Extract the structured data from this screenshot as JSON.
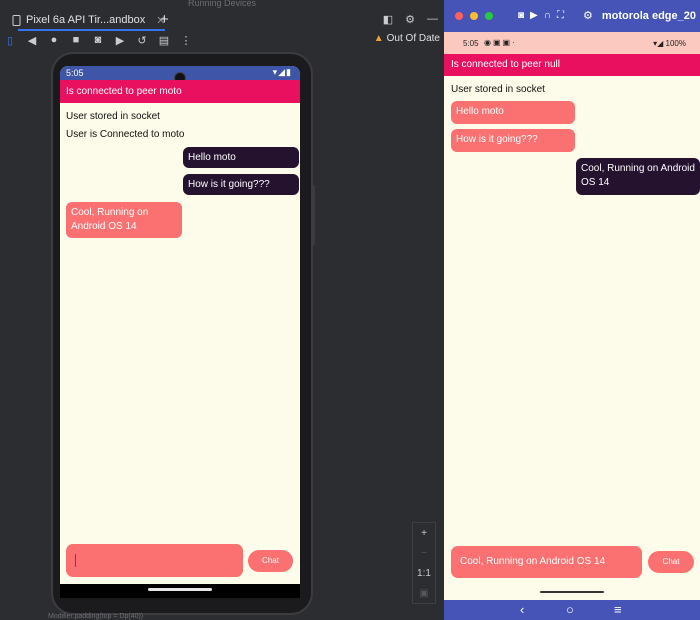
{
  "studio": {
    "header_text": "Running Devices",
    "tab_label": "Pixel 6a API Tir...andbox",
    "tab_close": "✕",
    "tab_add": "+",
    "status_label": "Out Of Date",
    "zoom_in": "+",
    "zoom_out": "−",
    "zoom_actual": "1:1",
    "bottom_text": "Modifier.padding(top = Dp(40))"
  },
  "emulator": {
    "status_time": "5:05",
    "status_icons": "▾◢▮",
    "appbar_title": "Is connected to peer moto",
    "info_lines": [
      "User stored in socket",
      "User is Connected to moto"
    ],
    "messages": [
      {
        "text": "Hello moto",
        "from": "self"
      },
      {
        "text": "How is it going???",
        "from": "self"
      },
      {
        "text": "Cool, Running on Android OS 14",
        "from": "peer"
      }
    ],
    "chat_button": "Chat"
  },
  "device_window": {
    "title": "motorola edge_20",
    "status_time": "5:05",
    "status_left_icons": "◉▣▣·",
    "status_right": "▾◢ 100%",
    "appbar_title": "Is connected to peer null",
    "info_line": "User stored in socket",
    "messages": [
      {
        "text": "Hello moto",
        "from": "peer"
      },
      {
        "text": "How is it going???",
        "from": "peer"
      },
      {
        "text": "Cool, Running on Android OS 14",
        "from": "self"
      }
    ],
    "input_value": "Cool, Running on Android OS 14",
    "chat_button": "Chat",
    "nav": {
      "back": "‹",
      "home": "○",
      "recents": "≡"
    }
  },
  "colors": {
    "app_bar": "#e8105f",
    "sent_bubble": "#24122f",
    "received_bubble": "#fb7070",
    "chat_background": "#fdfbe9",
    "window_titlebar": "#4654b8",
    "emulator_statusbar": "#3f56a8"
  }
}
